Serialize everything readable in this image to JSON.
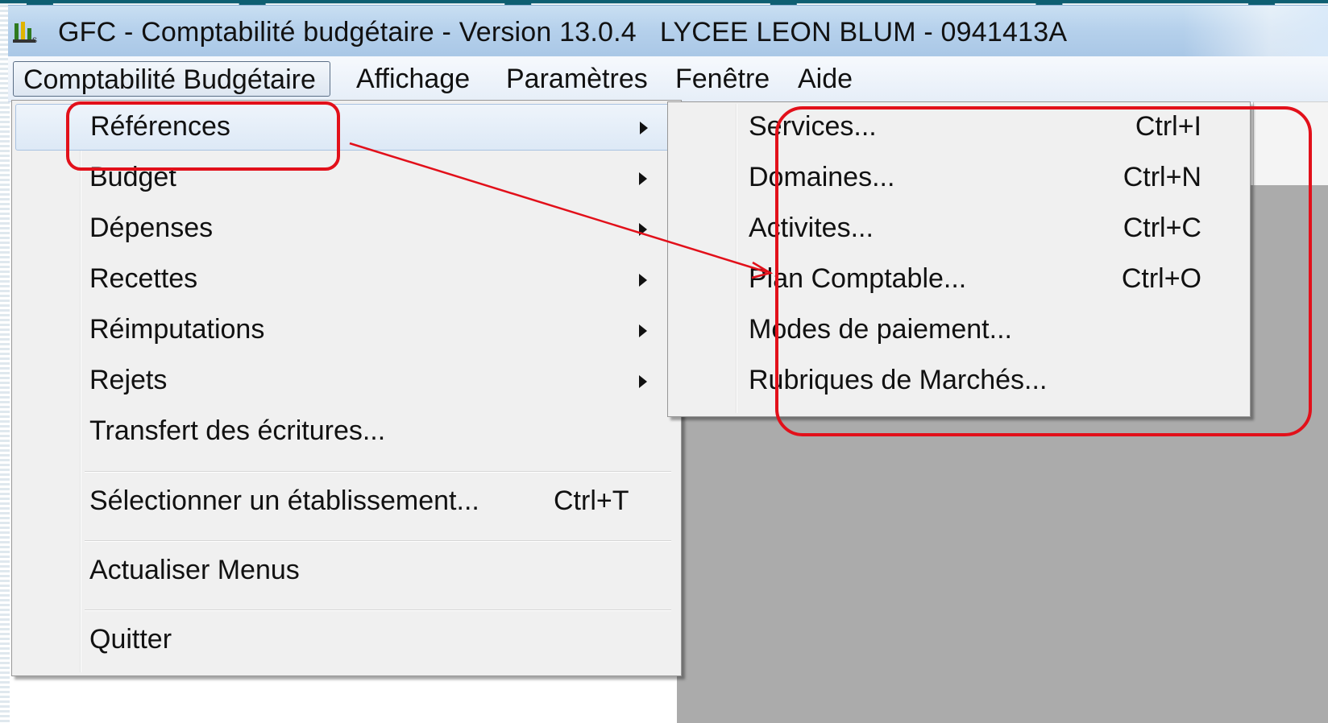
{
  "window": {
    "title": "GFC - Comptabilité budgétaire - Version 13.0.4   LYCEE LEON BLUM - 0941413A"
  },
  "menubar": {
    "items": [
      {
        "label": "Comptabilité Budgétaire",
        "active": true
      },
      {
        "label": "Affichage"
      },
      {
        "label": "Paramètres"
      },
      {
        "label": "Fenêtre"
      },
      {
        "label": "Aide"
      }
    ]
  },
  "dropdown": {
    "items": [
      {
        "label": "Références",
        "submenu": true,
        "highlighted": true
      },
      {
        "label": "Budget",
        "submenu": true
      },
      {
        "label": "Dépenses",
        "submenu": true
      },
      {
        "label": "Recettes",
        "submenu": true
      },
      {
        "label": "Réimputations",
        "submenu": true
      },
      {
        "label": "Rejets",
        "submenu": true
      },
      {
        "label": "Transfert des écritures..."
      },
      {
        "label": "Sélectionner un établissement...",
        "shortcut": "Ctrl+T"
      },
      {
        "label": "Actualiser Menus"
      },
      {
        "label": "Quitter"
      }
    ]
  },
  "submenu": {
    "items": [
      {
        "label": "Services...",
        "shortcut": "Ctrl+I"
      },
      {
        "label": "Domaines...",
        "shortcut": "Ctrl+N"
      },
      {
        "label": "Activites...",
        "shortcut": "Ctrl+C"
      },
      {
        "label": "Plan Comptable...",
        "shortcut": "Ctrl+O"
      },
      {
        "label": "Modes de paiement..."
      },
      {
        "label": "Rubriques de Marchés..."
      }
    ]
  },
  "colors": {
    "annotation": "#e2101a",
    "menu_bg": "#f0f0f0",
    "workspace": "#ababab",
    "titlebar": "#b6d1ec"
  },
  "icons": {
    "app": "gfc-app-icon",
    "submenu": "triangle-right-icon"
  }
}
